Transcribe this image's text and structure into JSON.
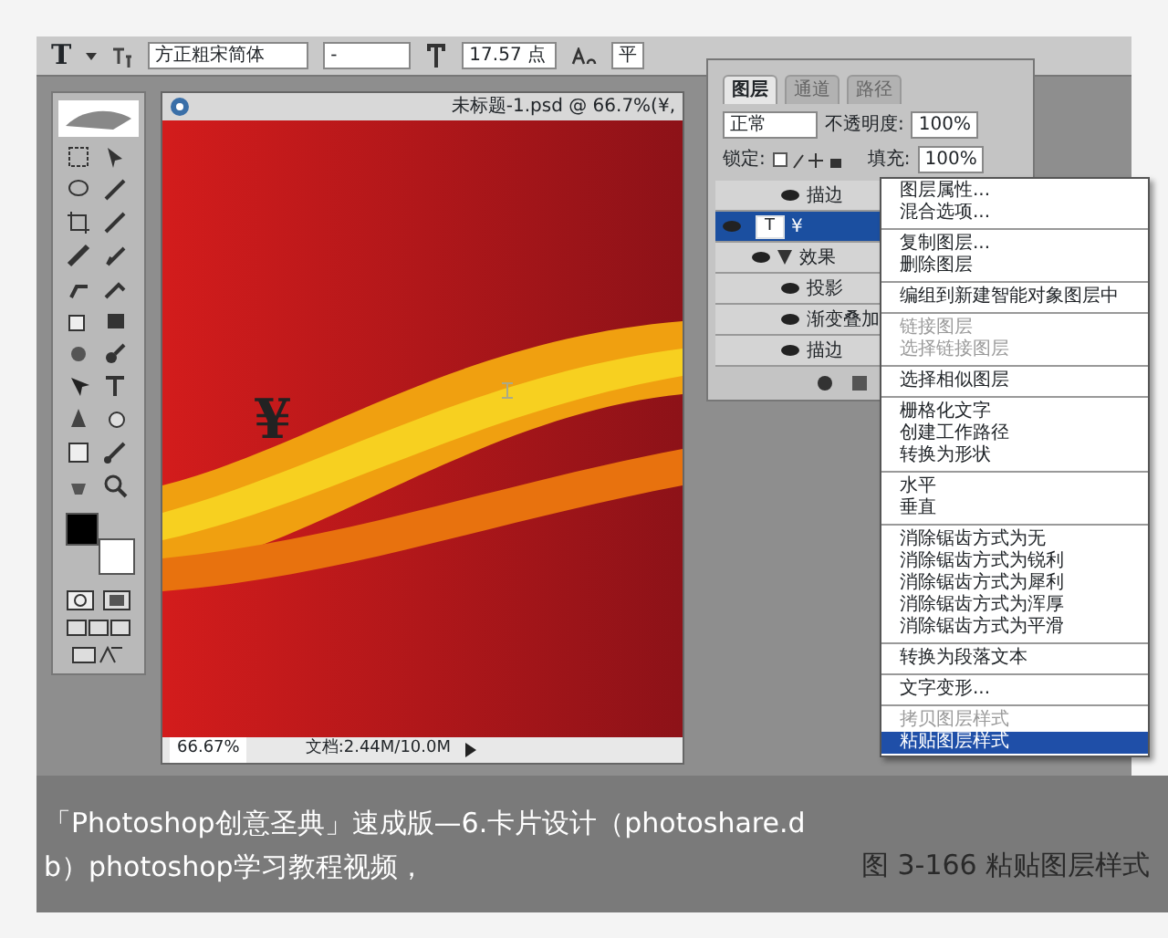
{
  "options_bar": {
    "tool": "T",
    "font_family": "方正粗宋简体",
    "font_style": "-",
    "font_size": "17.57 点",
    "antialias": "平"
  },
  "document": {
    "title": "未标题-1.psd @ 66.7%(¥,",
    "canvas_text": "¥",
    "zoom": "66.67%",
    "doc_info": "文档:2.44M/10.0M"
  },
  "layers_panel": {
    "tabs": [
      {
        "label": "图层",
        "selected": true
      },
      {
        "label": "通道",
        "selected": false
      },
      {
        "label": "路径",
        "selected": false
      }
    ],
    "blend_mode": "正常",
    "opacity_label": "不透明度:",
    "opacity": "100%",
    "lock_label": "锁定:",
    "fill_label": "填充:",
    "fill": "100%",
    "layers": [
      {
        "kind": "effect",
        "name": "描边",
        "selected": false
      },
      {
        "kind": "text",
        "thumb": "T",
        "name": "¥",
        "selected": true,
        "children": [
          {
            "kind": "header",
            "name": "效果",
            "selected": false,
            "children": [
              {
                "kind": "effect",
                "name": "投影",
                "selected": false
              },
              {
                "kind": "effect",
                "name": "渐变叠加",
                "selected": false
              },
              {
                "kind": "effect",
                "name": "描边",
                "selected": false
              }
            ]
          }
        ]
      }
    ]
  },
  "context_menu": {
    "groups": [
      [
        {
          "label": "图层属性...",
          "disabled": false,
          "selected": false
        },
        {
          "label": "混合选项...",
          "disabled": false,
          "selected": false
        }
      ],
      [
        {
          "label": "复制图层...",
          "disabled": false,
          "selected": false
        },
        {
          "label": "删除图层",
          "disabled": false,
          "selected": false
        }
      ],
      [
        {
          "label": "编组到新建智能对象图层中",
          "disabled": false,
          "selected": false
        }
      ],
      [
        {
          "label": "链接图层",
          "disabled": true,
          "selected": false
        },
        {
          "label": "选择链接图层",
          "disabled": true,
          "selected": false
        }
      ],
      [
        {
          "label": "选择相似图层",
          "disabled": false,
          "selected": false
        }
      ],
      [
        {
          "label": "栅格化文字",
          "disabled": false,
          "selected": false
        },
        {
          "label": "创建工作路径",
          "disabled": false,
          "selected": false
        },
        {
          "label": "转换为形状",
          "disabled": false,
          "selected": false
        }
      ],
      [
        {
          "label": "水平",
          "disabled": false,
          "selected": false
        },
        {
          "label": "垂直",
          "disabled": false,
          "selected": false
        }
      ],
      [
        {
          "label": "消除锯齿方式为无",
          "disabled": false,
          "selected": false
        },
        {
          "label": "消除锯齿方式为锐利",
          "disabled": false,
          "selected": false
        },
        {
          "label": "消除锯齿方式为犀利",
          "disabled": false,
          "selected": false
        },
        {
          "label": "消除锯齿方式为浑厚",
          "disabled": false,
          "selected": false
        },
        {
          "label": "消除锯齿方式为平滑",
          "disabled": false,
          "selected": false
        }
      ],
      [
        {
          "label": "转换为段落文本",
          "disabled": false,
          "selected": false
        }
      ],
      [
        {
          "label": "文字变形...",
          "disabled": false,
          "selected": false
        }
      ],
      [
        {
          "label": "拷贝图层样式",
          "disabled": true,
          "selected": false
        },
        {
          "label": "粘贴图层样式",
          "disabled": false,
          "selected": true
        }
      ]
    ]
  },
  "video_caption": "「Photoshop创意圣典」速成版—6.卡片设计（photoshare.db）photoshop学习教程视频，",
  "figure_caption": "图 3-166 粘贴图层样式"
}
